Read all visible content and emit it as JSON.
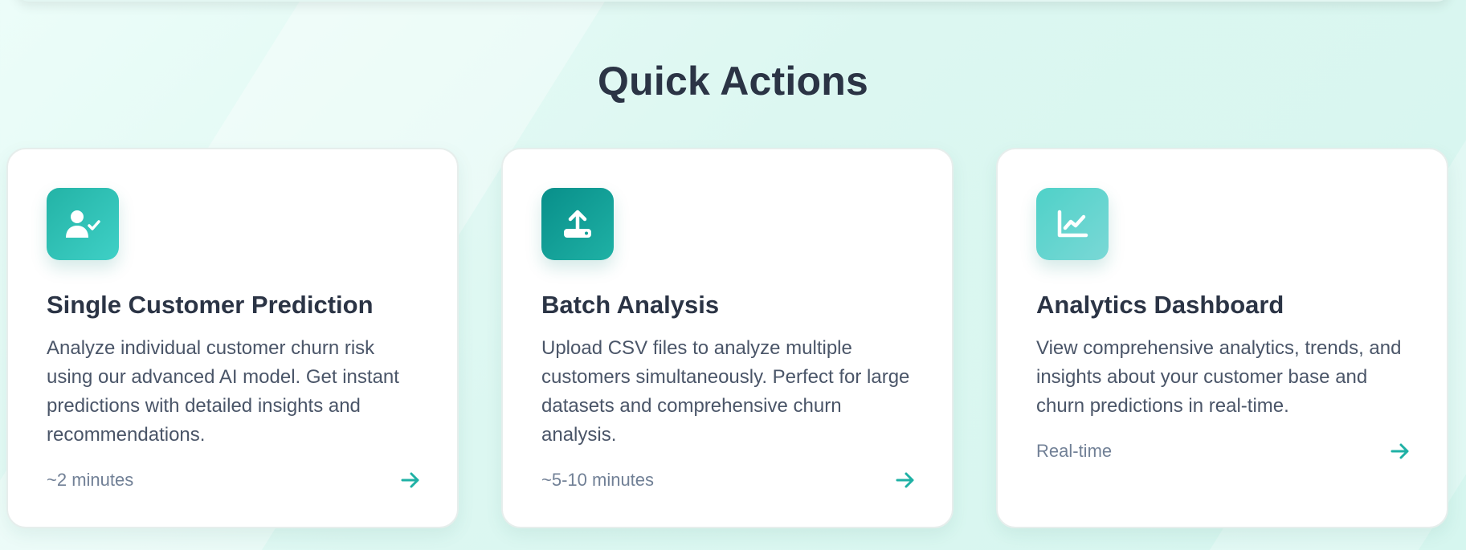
{
  "section": {
    "title": "Quick Actions"
  },
  "cards": [
    {
      "icon": "user-check-icon",
      "title": "Single Customer Prediction",
      "description": "Analyze individual customer churn risk using our advanced AI model. Get instant predictions with detailed insights and recommendations.",
      "time": "~2 minutes"
    },
    {
      "icon": "upload-icon",
      "title": "Batch Analysis",
      "description": "Upload CSV files to analyze multiple customers simultaneously. Perfect for large datasets and comprehensive churn analysis.",
      "time": "~5-10 minutes"
    },
    {
      "icon": "chart-line-icon",
      "title": "Analytics Dashboard",
      "description": "View comprehensive analytics, trends, and insights about your customer base and churn predictions in real-time.",
      "time": "Real-time"
    }
  ],
  "colors": {
    "accent": "#1fb1a5",
    "title_text": "#2b3445",
    "body_text": "#4a5568",
    "muted_text": "#718096"
  }
}
